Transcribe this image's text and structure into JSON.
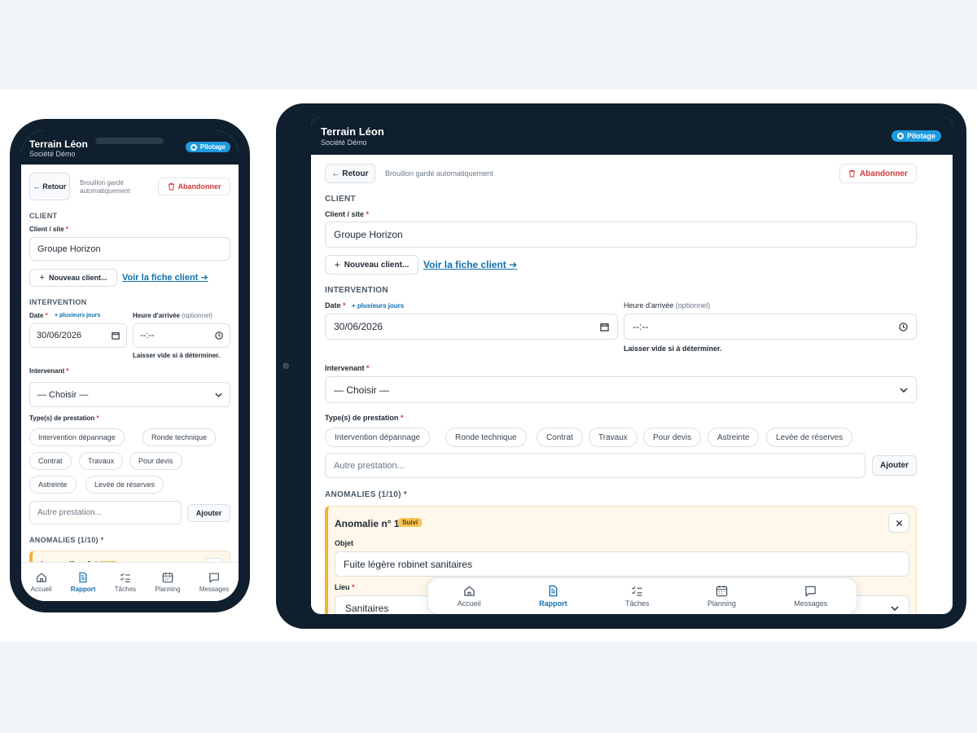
{
  "app": {
    "title": "Terrain Léon",
    "subtitle": "Société Démo",
    "badge": "Pilotage"
  },
  "toolbar": {
    "back_label": "← Retour",
    "draft_text": "Brouillon gardé automatiquement",
    "abandon_label": "Abandonner"
  },
  "client_section": {
    "title": "CLIENT",
    "field_label": "Client / site",
    "value": "Groupe Horizon",
    "new_client_label": "Nouveau client...",
    "view_link": "Voir la fiche client ➔"
  },
  "intervention": {
    "title": "INTERVENTION",
    "date_label": "Date",
    "plus_days": "+ plusieurs jours",
    "date_value": "30/06/2026",
    "arrival_label": "Heure d'arrivée",
    "optional": "(optionnel)",
    "time_value": "--:--",
    "hint": "Laisser vide si à déterminer.",
    "worker_label": "Intervenant",
    "worker_value": "— Choisir —",
    "types_label": "Type(s) de prestation",
    "types": [
      "Intervention dépannage",
      "Ronde technique",
      "Contrat",
      "Travaux",
      "Pour devis",
      "Astreinte",
      "Levée de réserves"
    ],
    "other_placeholder": "Autre prestation...",
    "add_label": "Ajouter"
  },
  "anomalies": {
    "title": "ANOMALIES (1/10) *",
    "item_title": "Anomalie n° 1",
    "tag": "Suivi",
    "object_label": "Objet",
    "object_value": "Fuite légère robinet sanitaires",
    "location_label": "Lieu",
    "location_value": "Sanitaires"
  },
  "required_mark": "*",
  "nav": [
    {
      "label": "Accueil",
      "icon": "home-icon"
    },
    {
      "label": "Rapport",
      "icon": "report-icon"
    },
    {
      "label": "Tâches",
      "icon": "tasks-icon"
    },
    {
      "label": "Planning",
      "icon": "calendar-icon"
    },
    {
      "label": "Messages",
      "icon": "messages-icon"
    }
  ],
  "colors": {
    "topbar": "#0f1f2e",
    "accent": "#0f6fb0",
    "badge": "#1e9be0",
    "danger": "#d13a3a",
    "anomaly": "#f2b233"
  }
}
